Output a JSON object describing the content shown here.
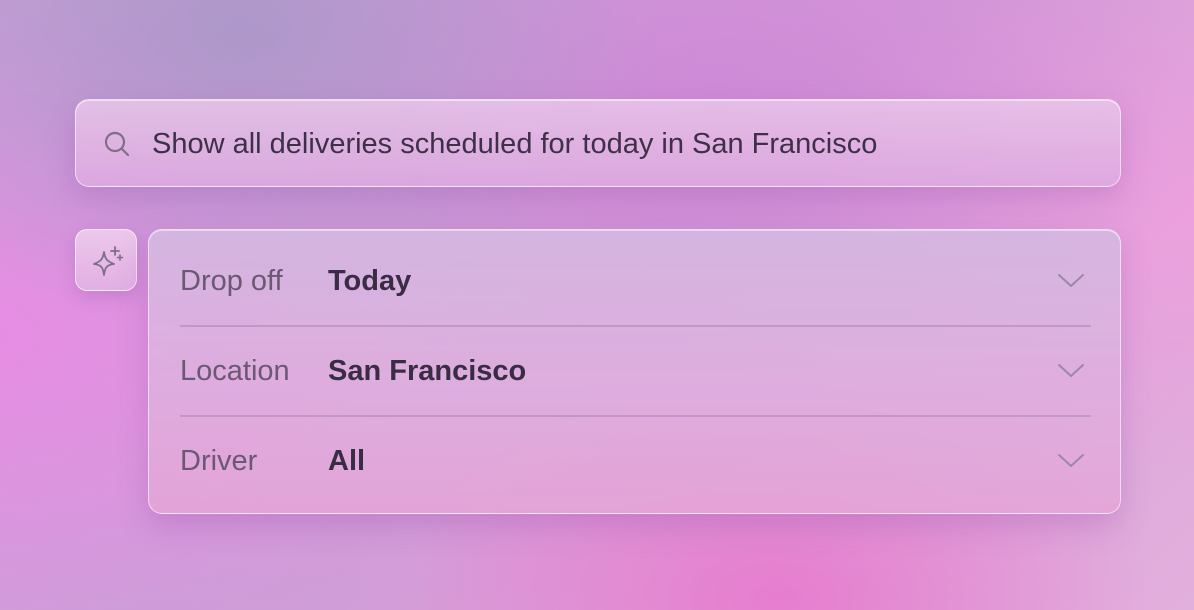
{
  "search": {
    "query": "Show all deliveries scheduled for today in San Francisco",
    "icon": "search-icon"
  },
  "ai_button": {
    "icon": "sparkle-icon"
  },
  "filters": [
    {
      "label": "Drop off",
      "value": "Today",
      "icon": "chevron-down-icon"
    },
    {
      "label": "Location",
      "value": "San Francisco",
      "icon": "chevron-down-icon"
    },
    {
      "label": "Driver",
      "value": "All",
      "icon": "chevron-down-icon"
    }
  ],
  "colors": {
    "text_primary": "#3a2c44",
    "text_secondary": "#6a5874",
    "icon": "#7e6e88"
  }
}
